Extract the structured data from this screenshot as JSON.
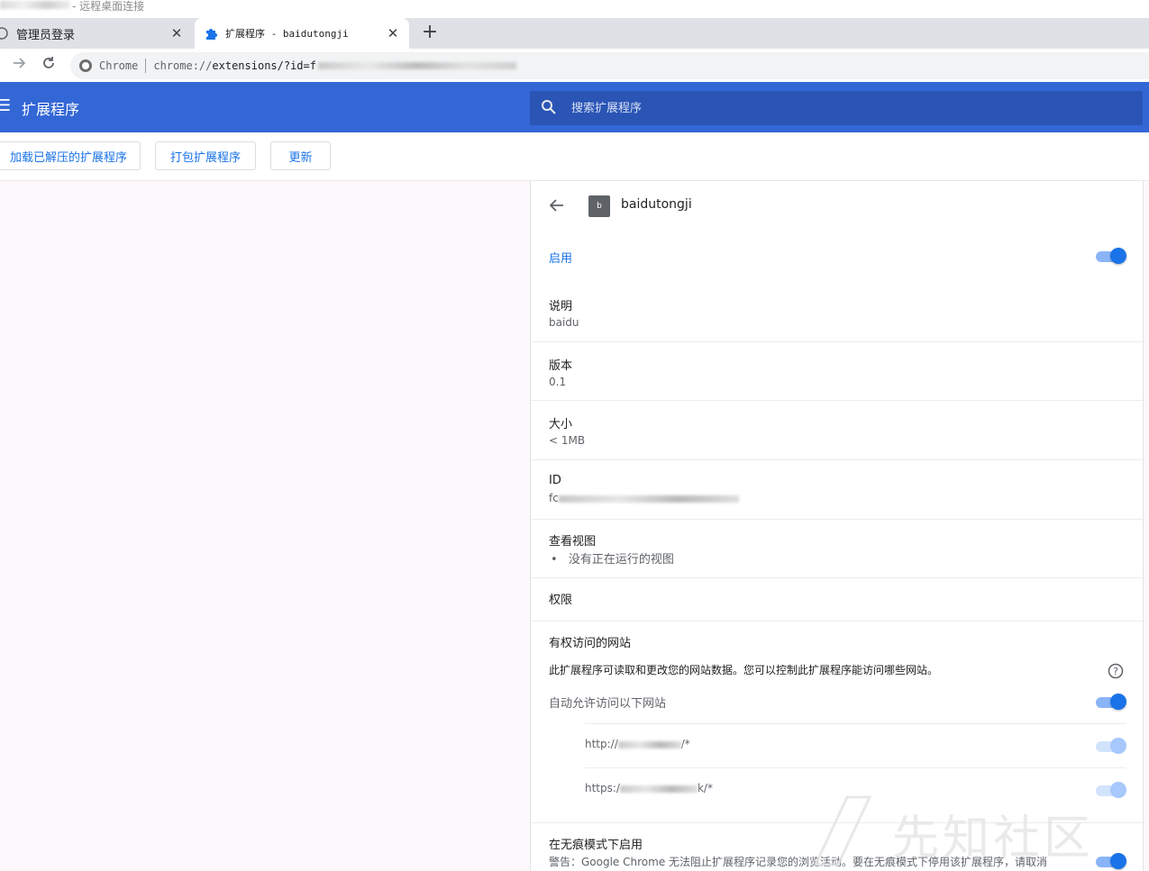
{
  "window": {
    "title_suffix": "- 远程桌面连接"
  },
  "tabs": [
    {
      "label": "管理员登录",
      "close": "✕"
    },
    {
      "label": "扩展程序 - baidutongji",
      "close": "✕"
    }
  ],
  "newtab": "+",
  "omnibox": {
    "chip_label": "Chrome",
    "url_scheme": "chrome://",
    "url_path": "extensions/?id=f"
  },
  "header": {
    "title": "扩展程序",
    "search_placeholder": "搜索扩展程序"
  },
  "devbar": {
    "load_unpacked": "加载已解压的扩展程序",
    "pack": "打包扩展程序",
    "update": "更新"
  },
  "detail": {
    "icon_letter": "b",
    "name": "baidutongji",
    "enabled_label": "启用",
    "description_label": "说明",
    "description_value": "baidu",
    "version_label": "版本",
    "version_value": "0.1",
    "size_label": "大小",
    "size_value": "< 1MB",
    "id_label": "ID",
    "id_value_prefix": "fc",
    "views_label": "查看视图",
    "views_bullet": "•",
    "views_value": "没有正在运行的视图",
    "permissions_label": "权限",
    "site_access_label": "有权访问的网站",
    "site_access_desc": "此扩展程序可读取和更改您的网站数据。您可以控制此扩展程序能访问哪些网站。",
    "auto_allow_label": "自动允许访问以下网站",
    "site1_prefix": "http://",
    "site1_suffix": "/*",
    "site2_prefix": "https:/",
    "site2_suffix": "k/*",
    "incognito_label": "在无痕模式下启用",
    "incognito_warning": "警告：Google Chrome 无法阻止扩展程序记录您的浏览活动。要在无痕模式下停用该扩展程序，请取消"
  },
  "watermark": "先知社区",
  "colors": {
    "header_blue": "#3367d6",
    "link_blue": "#1a73e8",
    "toggle_track": "#8ab4f8"
  }
}
